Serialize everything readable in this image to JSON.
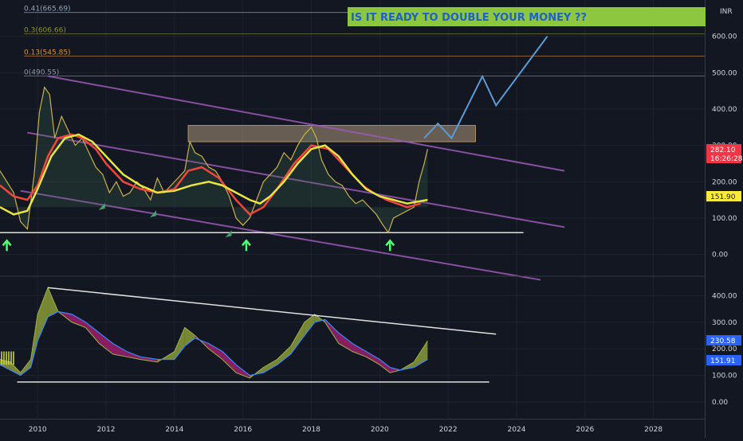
{
  "theme": {
    "background": "#131722",
    "axis_text": "#d1d4dc",
    "grid": "#1f2230",
    "price_line": "#c9b24b",
    "ma_fast": "#f2453d",
    "ma_slow": "#e8e442",
    "channel": "#9b59b6",
    "support": "#e0e0e0",
    "projection": "#5b9bd5",
    "zone_fill": "#e8c79a",
    "arrow_up": "#4cff72",
    "arrow_small": "#3fa56a",
    "banner_bg": "#8dc63f",
    "banner_text": "#1e62c8",
    "osc_line": "#3a86ff",
    "osc_pos": "#a3b83a",
    "osc_neg": "#b8227a",
    "badge_red": "#f23645",
    "badge_yellow": "#ffeb3b",
    "badge_blue": "#2962ff"
  },
  "banner": {
    "text": "IS IT READY TO DOUBLE YOUR MONEY ??"
  },
  "currency_label": "INR",
  "fib_levels": [
    {
      "label": "0.41(665.69)",
      "value": 665.69,
      "color": "#8fa3b8"
    },
    {
      "label": "0.3(606.66)",
      "value": 606.66,
      "color": "#8a8f3a"
    },
    {
      "label": "0.13(545.85)",
      "value": 545.85,
      "color": "#d8903a"
    },
    {
      "label": "0(490.55)",
      "value": 490.55,
      "color": "#8f96a3"
    }
  ],
  "badges": {
    "last_price": "282.10",
    "countdown": "16:26:28",
    "ma_value": "151.90",
    "osc_value_1": "230.58",
    "osc_value_2": "151.91"
  },
  "chart_data": [
    {
      "type": "line",
      "panel": "main",
      "x_axis": {
        "ticks": [
          "2010",
          "2012",
          "2014",
          "2016",
          "2018",
          "2020",
          "2022",
          "2024",
          "2026",
          "2028"
        ],
        "range": [
          2008.9,
          2029.5
        ]
      },
      "y_axis": {
        "ticks": [
          "0.00",
          "100.00",
          "200.00",
          "300.00",
          "400.00",
          "500.00",
          "600.00"
        ],
        "range": [
          -60,
          700
        ]
      },
      "series": [
        {
          "key": "price",
          "x": [
            2008.9,
            2009.1,
            2009.3,
            2009.5,
            2009.7,
            2009.9,
            2010.05,
            2010.2,
            2010.35,
            2010.5,
            2010.7,
            2010.9,
            2011.1,
            2011.3,
            2011.5,
            2011.7,
            2011.9,
            2012.1,
            2012.3,
            2012.5,
            2012.7,
            2012.9,
            2013.1,
            2013.3,
            2013.5,
            2013.7,
            2013.9,
            2014.1,
            2014.3,
            2014.45,
            2014.6,
            2014.8,
            2015.0,
            2015.2,
            2015.4,
            2015.6,
            2015.8,
            2016.0,
            2016.2,
            2016.4,
            2016.6,
            2016.8,
            2017.0,
            2017.2,
            2017.4,
            2017.6,
            2017.8,
            2018.0,
            2018.15,
            2018.3,
            2018.5,
            2018.7,
            2018.9,
            2019.1,
            2019.3,
            2019.5,
            2019.7,
            2019.9,
            2020.1,
            2020.25,
            2020.4,
            2020.6,
            2020.8,
            2021.0,
            2021.15,
            2021.3,
            2021.4
          ],
          "y": [
            230,
            200,
            170,
            90,
            70,
            220,
            390,
            460,
            440,
            320,
            380,
            340,
            300,
            320,
            280,
            240,
            220,
            170,
            200,
            160,
            170,
            200,
            180,
            150,
            210,
            170,
            190,
            210,
            230,
            310,
            280,
            270,
            240,
            230,
            200,
            160,
            100,
            80,
            100,
            150,
            200,
            220,
            240,
            280,
            260,
            300,
            330,
            350,
            320,
            260,
            220,
            200,
            190,
            160,
            140,
            150,
            130,
            110,
            80,
            60,
            100,
            110,
            120,
            130,
            200,
            250,
            290
          ]
        },
        {
          "key": "ma_fast",
          "x": [
            2008.9,
            2009.3,
            2009.7,
            2010.0,
            2010.3,
            2010.6,
            2011.0,
            2011.3,
            2011.7,
            2012.0,
            2012.5,
            2013.0,
            2013.5,
            2014.0,
            2014.4,
            2014.8,
            2015.3,
            2015.8,
            2016.2,
            2016.6,
            2017.0,
            2017.5,
            2018.0,
            2018.5,
            2019.0,
            2019.5,
            2019.8,
            2020.2,
            2020.5,
            2020.8,
            2021.2
          ],
          "y": [
            190,
            160,
            150,
            190,
            270,
            320,
            330,
            320,
            290,
            250,
            200,
            180,
            170,
            180,
            230,
            240,
            210,
            150,
            110,
            130,
            180,
            250,
            300,
            290,
            240,
            190,
            170,
            150,
            140,
            130,
            140
          ]
        },
        {
          "key": "ma_slow",
          "x": [
            2008.9,
            2009.3,
            2009.7,
            2010.0,
            2010.4,
            2010.8,
            2011.2,
            2011.6,
            2012.0,
            2012.5,
            2013.0,
            2013.5,
            2014.0,
            2014.5,
            2015.0,
            2015.4,
            2015.8,
            2016.2,
            2016.5,
            2016.8,
            2017.2,
            2017.6,
            2018.0,
            2018.4,
            2018.8,
            2019.2,
            2019.6,
            2020.0,
            2020.4,
            2020.8,
            2021.1,
            2021.4
          ],
          "y": [
            130,
            110,
            120,
            180,
            270,
            320,
            330,
            310,
            270,
            220,
            190,
            170,
            175,
            190,
            200,
            190,
            170,
            150,
            140,
            160,
            200,
            250,
            290,
            300,
            270,
            220,
            180,
            160,
            150,
            140,
            145,
            150
          ]
        }
      ],
      "channel_lines": [
        {
          "x": [
            2010.3,
            2025.4
          ],
          "y": [
            490.55,
            230
          ]
        },
        {
          "x": [
            2009.7,
            2025.4
          ],
          "y": [
            335,
            75
          ]
        },
        {
          "x": [
            2009.5,
            2024.7
          ],
          "y": [
            175,
            -70
          ]
        }
      ],
      "support_line": {
        "x": [
          2008.9,
          2024.2
        ],
        "y": [
          60,
          60
        ]
      },
      "resistance_zone": {
        "x": [
          2014.4,
          2022.8
        ],
        "y": [
          310,
          355
        ]
      },
      "projection": {
        "x": [
          2021.3,
          2021.7,
          2022.1,
          2023.0,
          2023.4,
          2024.9
        ],
        "y": [
          320,
          360,
          320,
          490,
          410,
          600
        ]
      },
      "markers": [
        {
          "kind": "up-arrow",
          "x": 2009.1,
          "y": 40
        },
        {
          "kind": "small-arrow",
          "x": 2011.9,
          "y": 135
        },
        {
          "kind": "small-arrow",
          "x": 2013.4,
          "y": 115
        },
        {
          "kind": "small-arrow",
          "x": 2015.6,
          "y": 60
        },
        {
          "kind": "up-arrow",
          "x": 2016.1,
          "y": 40
        },
        {
          "kind": "up-arrow",
          "x": 2020.3,
          "y": 40
        }
      ]
    },
    {
      "type": "area",
      "panel": "oscillator",
      "x_axis": {
        "ticks": [
          "2010",
          "2012",
          "2014",
          "2016",
          "2018",
          "2020",
          "2022",
          "2024",
          "2026",
          "2028"
        ],
        "range": [
          2008.9,
          2029.5
        ]
      },
      "y_axis": {
        "ticks": [
          "0.00",
          "100.00",
          "200.00",
          "300.00",
          "400.00"
        ],
        "range": [
          -60,
          470
        ]
      },
      "series": [
        {
          "key": "fast",
          "x": [
            2008.9,
            2009.2,
            2009.5,
            2009.8,
            2010.0,
            2010.3,
            2010.6,
            2011.0,
            2011.4,
            2011.8,
            2012.2,
            2012.6,
            2013.0,
            2013.5,
            2014.0,
            2014.3,
            2014.6,
            2015.0,
            2015.4,
            2015.8,
            2016.2,
            2016.6,
            2017.0,
            2017.4,
            2017.8,
            2018.1,
            2018.4,
            2018.8,
            2019.2,
            2019.6,
            2020.0,
            2020.3,
            2020.6,
            2021.0,
            2021.4
          ],
          "y": [
            160,
            150,
            110,
            160,
            330,
            430,
            340,
            300,
            280,
            220,
            180,
            170,
            160,
            150,
            190,
            280,
            250,
            200,
            160,
            110,
            90,
            130,
            160,
            210,
            300,
            330,
            300,
            220,
            190,
            170,
            140,
            110,
            120,
            150,
            230
          ]
        },
        {
          "key": "slow",
          "x": [
            2008.9,
            2009.2,
            2009.5,
            2009.8,
            2010.0,
            2010.3,
            2010.6,
            2011.0,
            2011.4,
            2011.8,
            2012.2,
            2012.6,
            2013.0,
            2013.5,
            2014.0,
            2014.3,
            2014.6,
            2015.0,
            2015.4,
            2015.8,
            2016.2,
            2016.6,
            2017.0,
            2017.4,
            2017.8,
            2018.1,
            2018.4,
            2018.8,
            2019.2,
            2019.6,
            2020.0,
            2020.3,
            2020.6,
            2021.0,
            2021.4
          ],
          "y": [
            140,
            120,
            100,
            130,
            230,
            320,
            340,
            330,
            300,
            260,
            220,
            190,
            170,
            160,
            160,
            210,
            240,
            220,
            190,
            140,
            100,
            110,
            140,
            180,
            250,
            300,
            310,
            260,
            220,
            190,
            160,
            130,
            120,
            130,
            160
          ]
        }
      ],
      "trend_lines": [
        {
          "x": [
            2010.3,
            2023.4
          ],
          "y": [
            430,
            255
          ]
        },
        {
          "x": [
            2009.4,
            2023.2
          ],
          "y": [
            75,
            75
          ]
        }
      ]
    }
  ]
}
